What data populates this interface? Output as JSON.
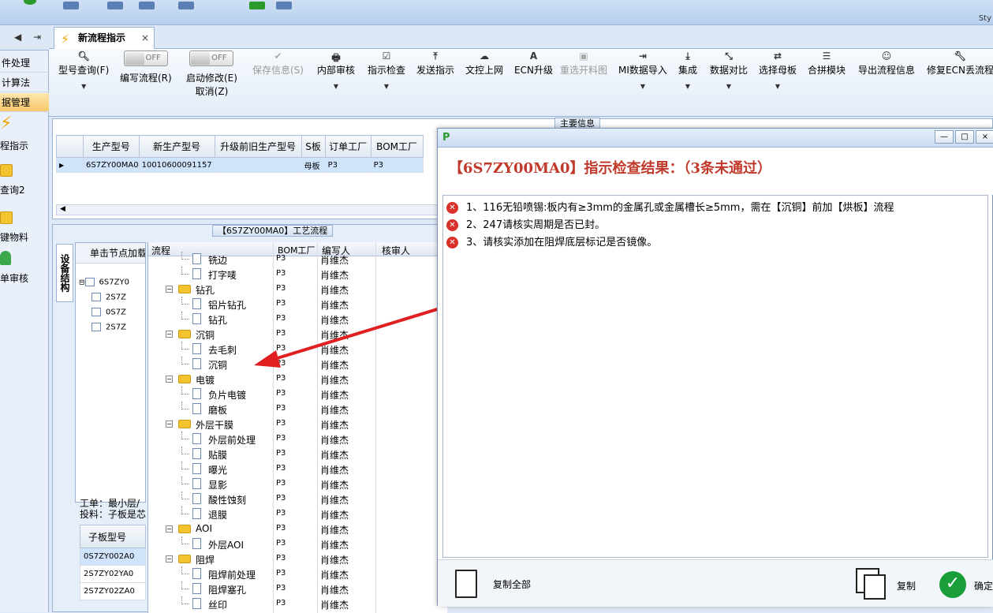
{
  "app": {
    "title_right": "Sty"
  },
  "left_nav": {
    "items": [
      {
        "label": "件处理",
        "active": false
      },
      {
        "label": "计算法",
        "active": false
      },
      {
        "label": "据管理",
        "active": true
      }
    ],
    "big_items": [
      {
        "label": "程指示",
        "icon": "lightning-icon"
      },
      {
        "label": "查询2",
        "icon": "folder-icon"
      },
      {
        "label": "键物料",
        "icon": "folder-icon"
      },
      {
        "label": "单审核",
        "icon": "user-icon"
      }
    ]
  },
  "tab": {
    "label": "新流程指示"
  },
  "toolbar": {
    "model_query": "型号查询(F)",
    "write_flow": "编写流程(R)",
    "write_flow_toggle": "OFF",
    "start_modify": "启动修改(E)",
    "cancel": "取消(Z)",
    "start_modify_toggle": "OFF",
    "save_info": "保存信息(S)",
    "internal_review": "内部审核",
    "instruction_check": "指示检查",
    "send_instruction": "发送指示",
    "document_upload": "文控上网",
    "ecn_upgrade": "ECN升级",
    "reselect_cutting": "重选开料图",
    "mi_import": "MI数据导入",
    "integrate": "集成",
    "data_compare": "数据对比",
    "select_master": "选择母板",
    "merge_module": "合拼模块",
    "export_flow": "导出流程信息",
    "repair_ecn": "修复ECN丢流程"
  },
  "main_info": {
    "title": "主要信息",
    "columns": [
      "生产型号",
      "新生产型号",
      "升级前旧生产型号",
      "S板",
      "订单工厂",
      "BOM工厂"
    ],
    "row": [
      "6S7ZY00MA0",
      "10010600091157",
      "",
      "母板",
      "P3",
      "P3"
    ]
  },
  "flow_panel": {
    "title": "【6S7ZY00MA0】工艺流程",
    "vertical_tab": "设备结构",
    "tree_header": "单击节点加载",
    "tree_nodes": [
      "6S7ZY0",
      "2S7Z",
      "0S7Z",
      "2S7Z"
    ],
    "info_line1": "工单：最小层/",
    "info_line2": "投料：子板是芯",
    "sub_header": "子板型号",
    "sub_rows": [
      "0S7ZY002A0",
      "2S7ZY02YA0",
      "2S7ZY02ZA0"
    ],
    "grid_headers": [
      "流程",
      "BOM工厂",
      "编写人",
      "核审人"
    ],
    "rows": [
      {
        "name": "铣边",
        "level": 2,
        "bom": "P3",
        "writer": "肖维杰"
      },
      {
        "name": "打字唛",
        "level": 2,
        "bom": "P3",
        "writer": "肖维杰"
      },
      {
        "name": "钻孔",
        "level": 1,
        "bom": "P3",
        "writer": "肖维杰"
      },
      {
        "name": "铝片钻孔",
        "level": 2,
        "bom": "P3",
        "writer": "肖维杰"
      },
      {
        "name": "钻孔",
        "level": 2,
        "bom": "P3",
        "writer": "肖维杰"
      },
      {
        "name": "沉铜",
        "level": 1,
        "bom": "P3",
        "writer": "肖维杰"
      },
      {
        "name": "去毛刺",
        "level": 2,
        "bom": "P3",
        "writer": "肖维杰"
      },
      {
        "name": "沉铜",
        "level": 2,
        "bom": "P3",
        "writer": "肖维杰"
      },
      {
        "name": "电镀",
        "level": 1,
        "bom": "P3",
        "writer": "肖维杰"
      },
      {
        "name": "负片电镀",
        "level": 2,
        "bom": "P3",
        "writer": "肖维杰"
      },
      {
        "name": "磨板",
        "level": 2,
        "bom": "P3",
        "writer": "肖维杰"
      },
      {
        "name": "外层干膜",
        "level": 1,
        "bom": "P3",
        "writer": "肖维杰"
      },
      {
        "name": "外层前处理",
        "level": 2,
        "bom": "P3",
        "writer": "肖维杰"
      },
      {
        "name": "贴膜",
        "level": 2,
        "bom": "P3",
        "writer": "肖维杰"
      },
      {
        "name": "曝光",
        "level": 2,
        "bom": "P3",
        "writer": "肖维杰"
      },
      {
        "name": "显影",
        "level": 2,
        "bom": "P3",
        "writer": "肖维杰"
      },
      {
        "name": "酸性蚀刻",
        "level": 2,
        "bom": "P3",
        "writer": "肖维杰"
      },
      {
        "name": "退膜",
        "level": 2,
        "bom": "P3",
        "writer": "肖维杰"
      },
      {
        "name": "AOI",
        "level": 1,
        "bom": "P3",
        "writer": "肖维杰"
      },
      {
        "name": "外层AOI",
        "level": 2,
        "bom": "P3",
        "writer": "肖维杰"
      },
      {
        "name": "阻焊",
        "level": 1,
        "bom": "P3",
        "writer": "肖维杰"
      },
      {
        "name": "阻焊前处理",
        "level": 2,
        "bom": "P3",
        "writer": "肖维杰"
      },
      {
        "name": "阻焊塞孔",
        "level": 2,
        "bom": "P3",
        "writer": "肖维杰"
      },
      {
        "name": "丝印",
        "level": 2,
        "bom": "P3",
        "writer": "肖维杰"
      }
    ]
  },
  "dialog": {
    "logo": "P",
    "heading": "【6S7ZY00MA0】指示检查结果：（3条未通过）",
    "messages": [
      "1、116无铅喷锡:板内有≥3mm的金属孔或金属槽长≥5mm，需在【沉铜】前加【烘板】流程",
      "2、247请核实周期是否已封。",
      "3、请核实添加在阻焊底层标记是否镜像。"
    ],
    "copy_all": "复制全部",
    "copy": "复制",
    "confirm": "确定"
  },
  "colors": {
    "error": "#d9302a",
    "heading": "#c0392b",
    "arrow": "#e02020",
    "ok": "#1a9e3a"
  }
}
